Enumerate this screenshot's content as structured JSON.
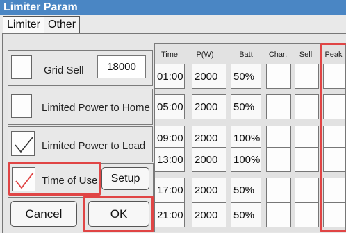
{
  "title": "Limiter Param",
  "tabs": [
    "Limiter",
    "Other"
  ],
  "left": {
    "grid_sell": {
      "label": "Grid Sell",
      "value": "18000",
      "checked": false
    },
    "limited_home": {
      "label": "Limited Power to Home",
      "checked": false
    },
    "limited_load": {
      "label": "Limited Power to Load",
      "checked": true
    },
    "time_of_use": {
      "label": "Time of Use",
      "checked": true
    },
    "setup_label": "Setup",
    "cancel_label": "Cancel",
    "ok_label": "OK"
  },
  "table": {
    "headers": [
      "Time",
      "P(W)",
      "Batt",
      "Char.",
      "Sell",
      "Peak"
    ],
    "rows": [
      {
        "time": "01:00",
        "power": "2000",
        "batt": "50%"
      },
      {
        "time": "05:00",
        "power": "2000",
        "batt": "50%"
      },
      {
        "time": "09:00",
        "power": "2000",
        "batt": "100%"
      },
      {
        "time": "13:00",
        "power": "2000",
        "batt": "100%"
      },
      {
        "time": "17:00",
        "power": "2000",
        "batt": "50%"
      },
      {
        "time": "21:00",
        "power": "2000",
        "batt": "50%"
      }
    ]
  },
  "colors": {
    "titlebar": "#4a86c4",
    "highlight": "#e04545",
    "check_red": "#e04545",
    "check_dark": "#333333"
  },
  "icons": {
    "check": "check-icon"
  }
}
